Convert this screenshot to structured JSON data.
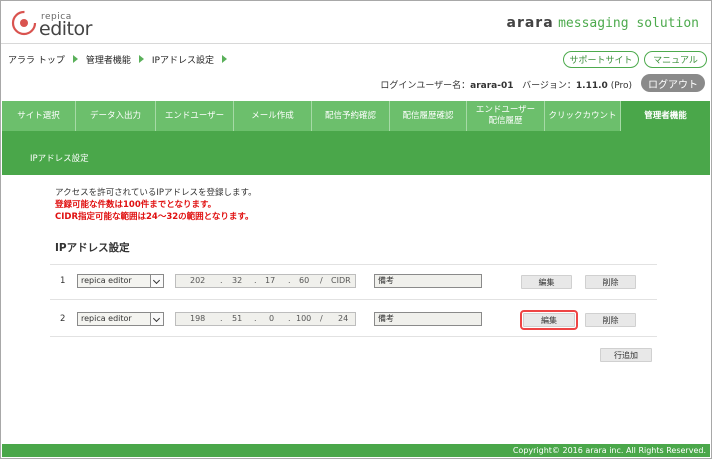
{
  "header": {
    "logo_small": "repica",
    "logo_big": "editor",
    "brand_bold": "arara",
    "brand_rest": "messaging solution"
  },
  "breadcrumb": [
    "アララ トップ",
    "管理者機能",
    "IPアドレス設定"
  ],
  "top_buttons": {
    "support": "サポートサイト",
    "manual": "マニュアル"
  },
  "login": {
    "label": "ログインユーザー名：",
    "user": "arara-01",
    "version_label": "バージョン：",
    "version": "1.11.0",
    "edition": "(Pro)",
    "logout": "ログアウト"
  },
  "nav": [
    {
      "label": "サイト選択"
    },
    {
      "label": "データ入出力"
    },
    {
      "label": "エンドユーザー"
    },
    {
      "label": "メール作成"
    },
    {
      "label": "配信予約確認"
    },
    {
      "label": "配信履歴確認"
    },
    {
      "label": "エンドユーザー\n配信履歴"
    },
    {
      "label": "クリックカウント"
    },
    {
      "label": "管理者機能"
    }
  ],
  "section_title": "IPアドレス設定",
  "desc": {
    "line1": "アクセスを許可されているIPアドレスを登録します。",
    "line2": "登録可能な件数は100件までとなります。",
    "line3": "CIDR指定可能な範囲は24～32の範囲となります。"
  },
  "heading": "IPアドレス設定",
  "rows": [
    {
      "num": "1",
      "select": "repica editor",
      "ip": [
        "202",
        "32",
        "17",
        "60"
      ],
      "cidr": "CIDR",
      "note": "備考",
      "edit": "編集",
      "delete": "削除"
    },
    {
      "num": "2",
      "select": "repica editor",
      "ip": [
        "198",
        "51",
        "0",
        "100"
      ],
      "cidr": "24",
      "note": "備考",
      "edit": "編集",
      "delete": "削除"
    }
  ],
  "add_row": "行追加",
  "footer": "Copyright© 2016 arara inc. All Rights Reserved."
}
